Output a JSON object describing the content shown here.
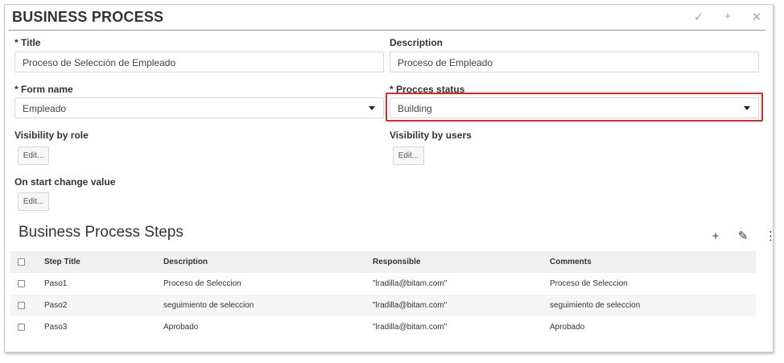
{
  "header": {
    "title": "BUSINESS PROCESS",
    "actions": [
      {
        "icon": "check-icon",
        "glyph": "✓"
      },
      {
        "icon": "plus-icon",
        "glyph": "+"
      },
      {
        "icon": "close-icon",
        "glyph": "✕"
      }
    ]
  },
  "form": {
    "title_label": "Title",
    "title_value": "Proceso de Selección de Empleado",
    "description_label": "Description",
    "description_value": "Proceso de Empleado",
    "form_name_label": "Form name",
    "form_name_value": "Empleado",
    "process_status_label": "Procces status",
    "process_status_value": "Building",
    "visibility_role_label": "Visibility by role",
    "visibility_users_label": "Visibility by users",
    "on_start_label": "On start change value",
    "edit_label": "Edit...",
    "required_mark": "*",
    "highlight_color": "#d42a2a"
  },
  "steps": {
    "title": "Business Process Steps",
    "actions": [
      {
        "icon": "plus-icon",
        "glyph": "+"
      },
      {
        "icon": "edit-list-icon",
        "glyph": "✎"
      },
      {
        "icon": "more-vertical-icon",
        "glyph": "⋮"
      }
    ],
    "columns": [
      "Step Title",
      "Description",
      "Responsible",
      "Comments"
    ],
    "rows": [
      {
        "title": "Paso1",
        "description": "Proceso de Seleccion",
        "responsible": "\"lradilla@bitam.com\"",
        "comments": "Proceso de Seleccion"
      },
      {
        "title": "Paso2",
        "description": "seguimiento de seleccion",
        "responsible": "\"lradilla@bitam.com\"",
        "comments": "seguimiento de seleccion"
      },
      {
        "title": "Paso3",
        "description": "Aprobado",
        "responsible": "\"lradilla@bitam.com\"",
        "comments": "Aprobado"
      }
    ]
  }
}
